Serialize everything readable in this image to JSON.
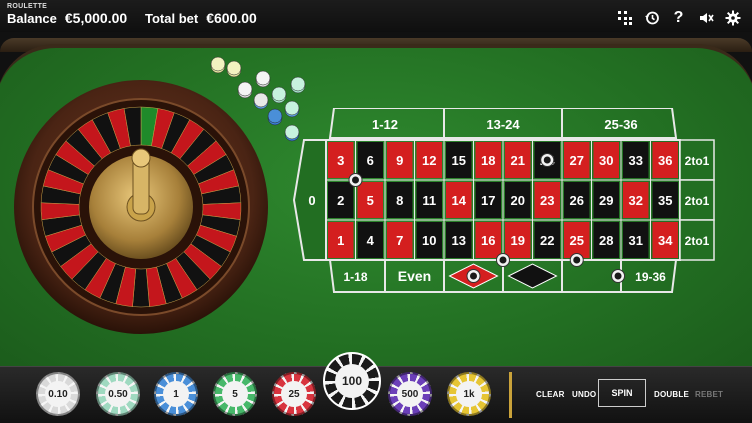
{
  "header": {
    "game_title": "ROULETTE",
    "balance_label": "Balance",
    "balance_value": "€5,000.00",
    "total_bet_label": "Total bet",
    "total_bet_value": "€600.00"
  },
  "icons": [
    "grid-dots-icon",
    "history-icon",
    "help-icon",
    "sound-icon",
    "settings-icon"
  ],
  "board": {
    "dozens": [
      "1-12",
      "13-24",
      "25-36"
    ],
    "zero": "0",
    "rows": [
      [
        "3",
        "6",
        "9",
        "12",
        "15",
        "18",
        "21",
        "24",
        "27",
        "30",
        "33",
        "36"
      ],
      [
        "2",
        "5",
        "8",
        "11",
        "14",
        "17",
        "20",
        "23",
        "26",
        "29",
        "32",
        "35"
      ],
      [
        "1",
        "4",
        "7",
        "10",
        "13",
        "16",
        "19",
        "22",
        "25",
        "28",
        "31",
        "34"
      ]
    ],
    "red_numbers": [
      "1",
      "3",
      "5",
      "7",
      "9",
      "12",
      "14",
      "16",
      "18",
      "19",
      "21",
      "23",
      "25",
      "27",
      "30",
      "32",
      "34",
      "36"
    ],
    "columns": [
      "2to1",
      "2to1",
      "2to1"
    ],
    "outside": [
      "1-18",
      "Even",
      "",
      "",
      "",
      "19-36"
    ]
  },
  "colors": {
    "felt": "#2b7f2b",
    "red": "#d41f1f",
    "black": "#111111",
    "board_line": "#e8e8e8",
    "accent_gold": "#c9a23a"
  },
  "chips": [
    {
      "label": "0.10",
      "color": "#d9d9d9"
    },
    {
      "label": "0.50",
      "color": "#9fd9c0"
    },
    {
      "label": "1",
      "color": "#4a8fd8"
    },
    {
      "label": "5",
      "color": "#47b86a"
    },
    {
      "label": "25",
      "color": "#d8343f"
    },
    {
      "label": "100",
      "color": "#1a1a1a"
    },
    {
      "label": "500",
      "color": "#6b3fb8"
    },
    {
      "label": "1k",
      "color": "#e6c534"
    }
  ],
  "selected_chip": "100",
  "controls": {
    "clear": "CLEAR",
    "undo": "UNDO",
    "spin": "SPIN",
    "double": "DOUBLE",
    "rebet": "REBET"
  }
}
